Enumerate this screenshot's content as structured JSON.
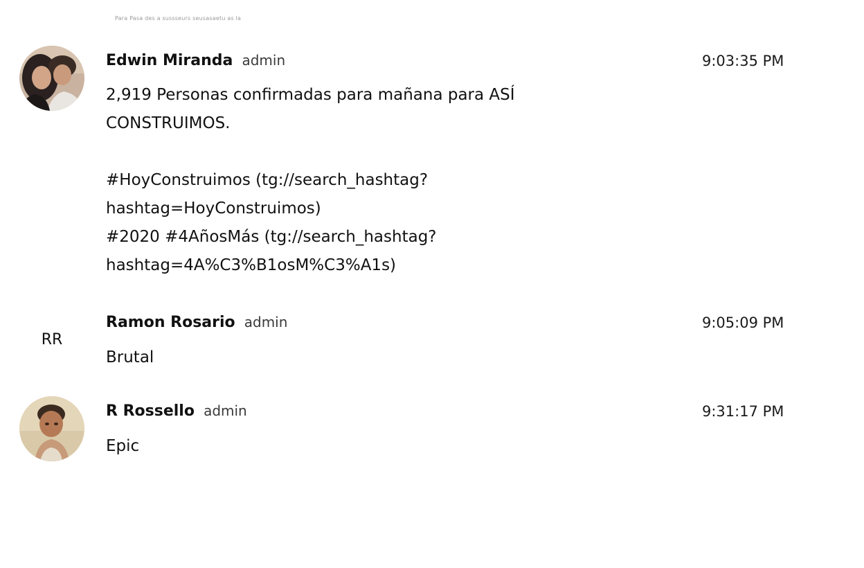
{
  "top_fragment": "Para Pasa des a sussseurs seusasaetu as la",
  "messages": [
    {
      "sender": "Edwin Miranda",
      "role": "admin",
      "time": "9:03:35 PM",
      "avatar": "photo-avatar",
      "lines": [
        "2,919 Personas confirmadas para mañana para ASÍ",
        "CONSTRUIMOS.",
        "",
        "#HoyConstruimos (tg://search_hashtag?",
        "hashtag=HoyConstruimos)",
        "#2020 #4AñosMás (tg://search_hashtag?",
        "hashtag=4A%C3%B1osM%C3%A1s)"
      ]
    },
    {
      "sender": "Ramon Rosario",
      "role": "admin",
      "time": "9:05:09 PM",
      "avatar_initials": "RR",
      "lines": [
        "Brutal"
      ]
    },
    {
      "sender": "R Rossello",
      "role": "admin",
      "time": "9:31:17 PM",
      "avatar": "photo-avatar",
      "lines": [
        "Epic"
      ]
    }
  ]
}
